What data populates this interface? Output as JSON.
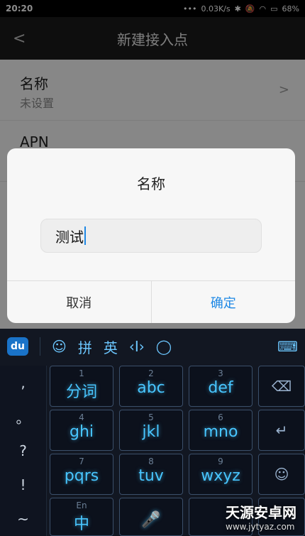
{
  "status": {
    "time": "20:20",
    "net_speed": "0.03K/s",
    "battery": "68%"
  },
  "titlebar": {
    "title": "新建接入点"
  },
  "settings": {
    "rows": [
      {
        "label": "名称",
        "sub": "未设置"
      },
      {
        "label": "APN",
        "sub": ""
      }
    ]
  },
  "dialog": {
    "title": "名称",
    "input_value": "测试",
    "cancel_label": "取消",
    "ok_label": "确定"
  },
  "keyboard": {
    "toolbar": {
      "brand": "du",
      "pinyin_label": "拼",
      "english_label": "英"
    },
    "left_keys": [
      ",",
      "。",
      "?",
      "!",
      "~"
    ],
    "keys": [
      {
        "num": "1",
        "label": "分词"
      },
      {
        "num": "2",
        "label": "abc"
      },
      {
        "num": "3",
        "label": "def"
      },
      {
        "num": "4",
        "label": "ghi"
      },
      {
        "num": "5",
        "label": "jkl"
      },
      {
        "num": "6",
        "label": "mno"
      },
      {
        "num": "7",
        "label": "pqrs"
      },
      {
        "num": "8",
        "label": "tuv"
      },
      {
        "num": "9",
        "label": "wxyz"
      }
    ],
    "bottom_left_label": "中",
    "bottom_left_sub": "En"
  },
  "watermark": {
    "text": "天源安卓网",
    "url": "www.jytyaz.com"
  },
  "colors": {
    "accent": "#1e88e5",
    "key_glow": "#48c6ff"
  }
}
